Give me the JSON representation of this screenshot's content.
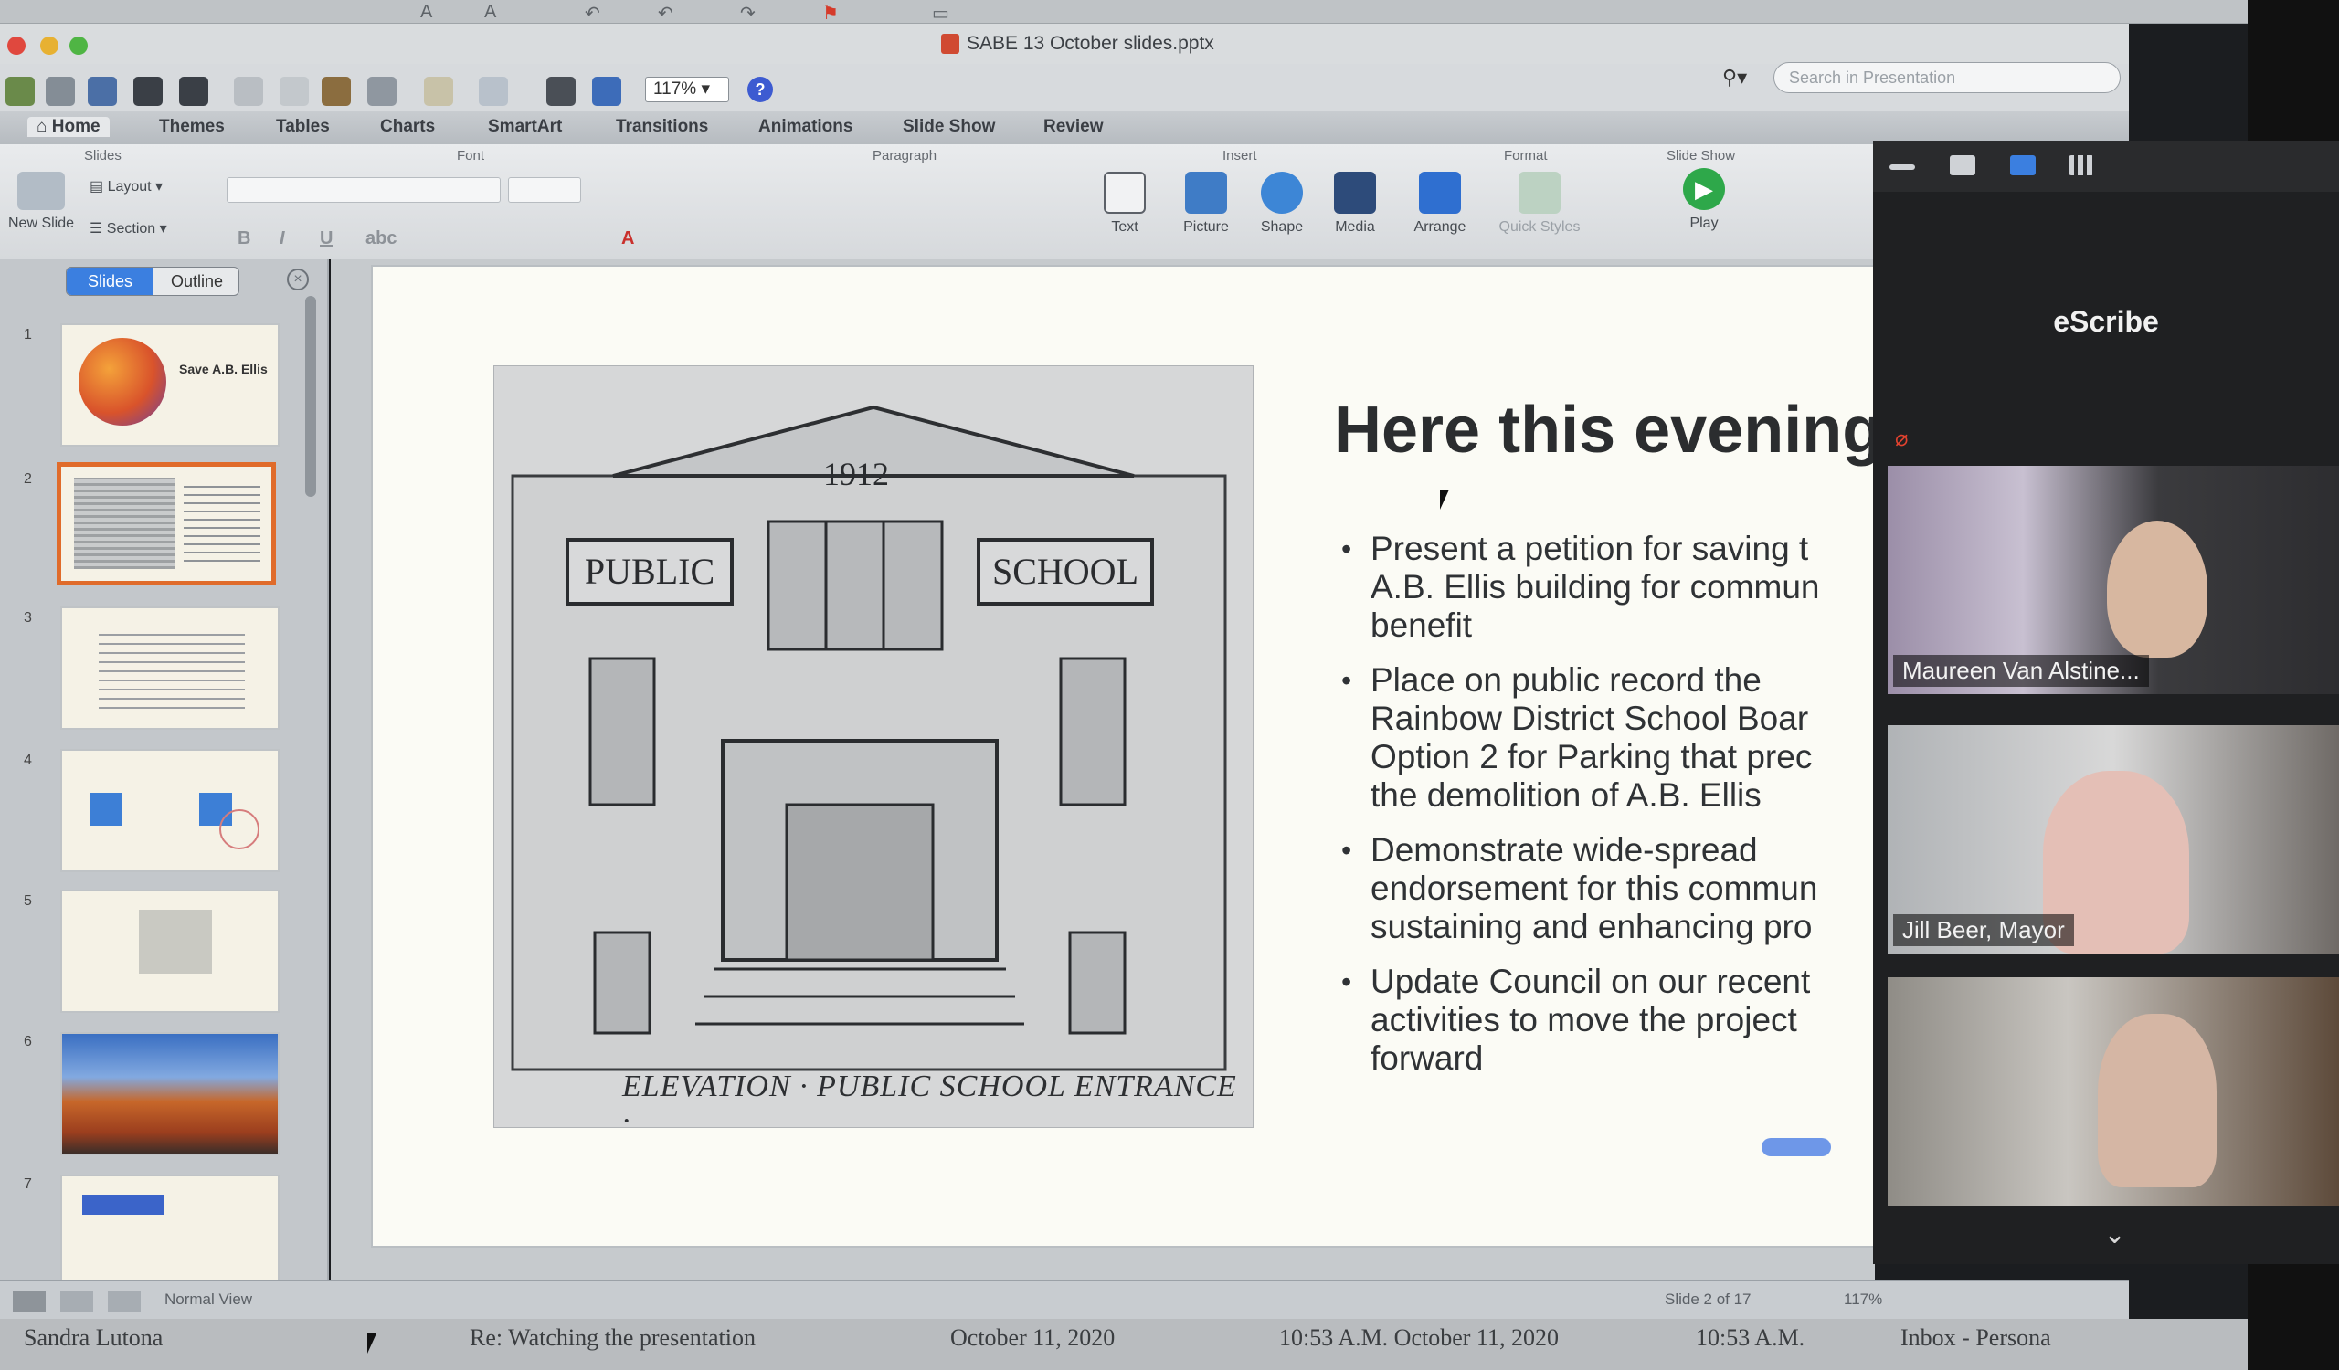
{
  "window": {
    "title": "SABE 13 October slides.pptx",
    "zoom": "117%",
    "search_placeholder": "Search in Presentation"
  },
  "ribbon": {
    "tabs": [
      "Home",
      "Themes",
      "Tables",
      "Charts",
      "SmartArt",
      "Transitions",
      "Animations",
      "Slide Show",
      "Review"
    ],
    "groups": {
      "slides": "Slides",
      "font": "Font",
      "paragraph": "Paragraph",
      "insert": "Insert",
      "format": "Format",
      "slideshow": "Slide Show"
    },
    "buttons": {
      "new_slide": "New Slide",
      "layout": "Layout",
      "section": "Section",
      "text": "Text",
      "picture": "Picture",
      "shape": "Shape",
      "media": "Media",
      "arrange": "Arrange",
      "quick_styles": "Quick Styles",
      "play": "Play"
    }
  },
  "sidebar": {
    "tab_slides": "Slides",
    "tab_outline": "Outline",
    "thumb_numbers": [
      "1",
      "2",
      "3",
      "4",
      "5",
      "6",
      "7"
    ],
    "thumb1_title": "Save A.B. Ellis"
  },
  "slide": {
    "title": "Here this evening",
    "image_caption": "ELEVATION · PUBLIC SCHOOL ENTRANCE ·",
    "sketch_labels": {
      "year": "1912",
      "left_sign": "PUBLIC",
      "right_sign": "SCHOOL"
    },
    "bullets": [
      [
        "Present a petition for saving t",
        "A.B. Ellis building for commun",
        "benefit"
      ],
      [
        "Place on public record the",
        "Rainbow District School Boar",
        "Option 2 for Parking that prec",
        "the demolition of A.B. Ellis"
      ],
      [
        "Demonstrate wide-spread",
        "endorsement for this commun",
        "sustaining and enhancing pro"
      ],
      [
        "Update Council on our recent",
        "activities to move the project",
        "forward"
      ]
    ]
  },
  "status": {
    "view": "Normal View",
    "slide_counter": "Slide 2 of 17",
    "zoom": "117%"
  },
  "background_text": {
    "sender": "Sandra Lutona",
    "subject": "Re: Watching the presentation",
    "date": "October 11, 2020",
    "time1": "10:53 A.M. October 11, 2020",
    "time2": "10:53 A.M.",
    "mailbox": "Inbox - Persona"
  },
  "meeting": {
    "active_name": "eScribe",
    "participants": [
      "Maureen Van Alstine...",
      "Jill Beer, Mayor",
      ""
    ]
  },
  "colors": {
    "accent_blue": "#3b7fe0",
    "selection_orange": "#e06b2a",
    "play_green": "#2ea84a",
    "mute_red": "#e2422f"
  }
}
